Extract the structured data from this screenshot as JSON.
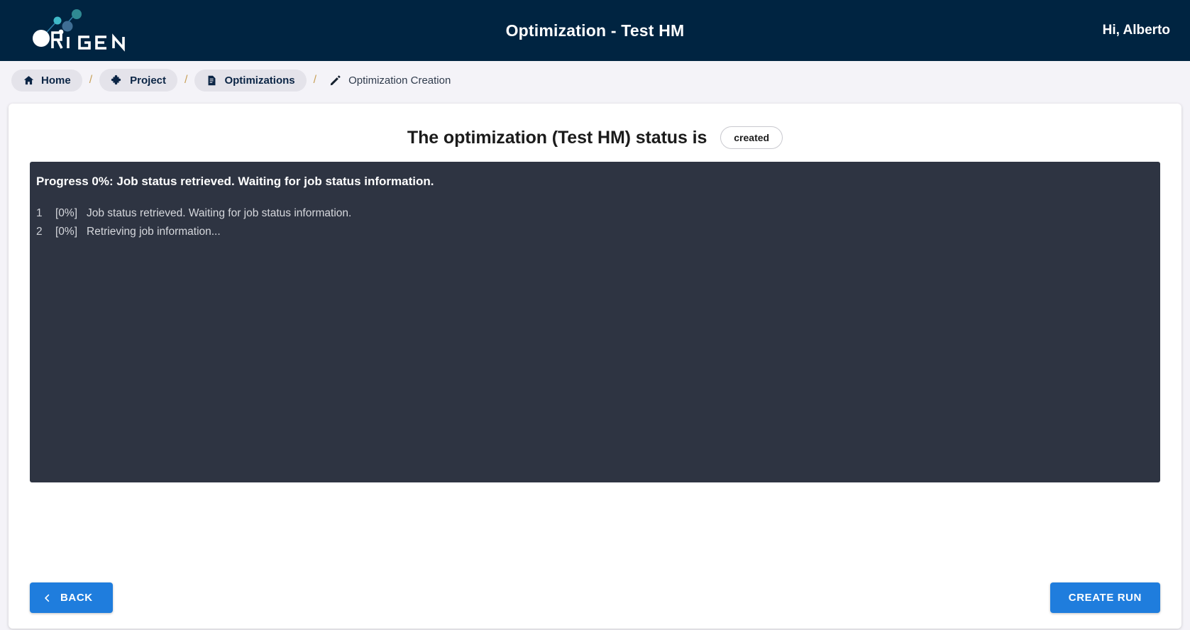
{
  "header": {
    "logo_text": "ORIGEN",
    "title": "Optimization - Test HM",
    "user_greeting": "Hi, Alberto",
    "brand_bg": "#002441"
  },
  "breadcrumb": {
    "separator": "/",
    "items": [
      {
        "label": "Home",
        "icon": "home-icon",
        "active": true
      },
      {
        "label": "Project",
        "icon": "puzzle-icon",
        "active": true
      },
      {
        "label": "Optimizations",
        "icon": "document-icon",
        "active": true
      },
      {
        "label": "Optimization Creation",
        "icon": "pencil-icon",
        "active": false
      }
    ]
  },
  "main": {
    "status_prefix": "The optimization (Test HM) status is",
    "status_badge": "created",
    "console": {
      "progress_header": "Progress 0%: Job status retrieved. Waiting for job status information.",
      "lines": [
        {
          "num": "1",
          "pct": "[0%]",
          "msg": "Job status retrieved. Waiting for job status information."
        },
        {
          "num": "2",
          "pct": "[0%]",
          "msg": "Retrieving job information..."
        }
      ],
      "bg": "#2e3442"
    }
  },
  "footer": {
    "back_label": "BACK",
    "create_run_label": "CREATE RUN",
    "button_color": "#1f7ddd"
  }
}
